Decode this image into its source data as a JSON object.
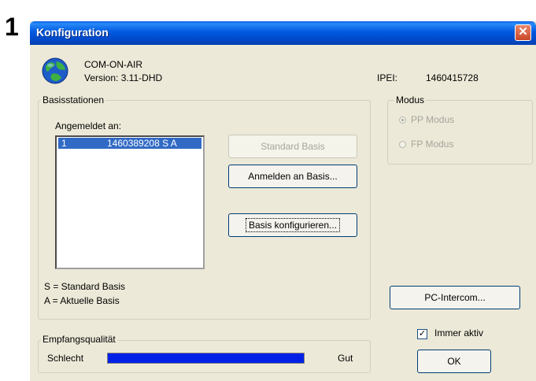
{
  "step_number": "1",
  "window": {
    "title": "Konfiguration",
    "close_glyph": "✕",
    "icon": "globe-icon"
  },
  "app": {
    "name": "COM-ON-AIR",
    "version": "Version: 3.11-DHD"
  },
  "ipei": {
    "label": "IPEI:",
    "value": "1460415728"
  },
  "basisstationen": {
    "legend": "Basisstationen",
    "list_label": "Angemeldet an:",
    "items": [
      {
        "index": "1",
        "text": "1460389208 S A",
        "selected": true
      }
    ],
    "legend_s": "S = Standard Basis",
    "legend_a": "A = Aktuelle Basis"
  },
  "buttons": {
    "standard_basis": "Standard Basis",
    "anmelden": "Anmelden an Basis...",
    "konfigurieren": "Basis konfigurieren...",
    "pc_intercom": "PC-Intercom...",
    "ok": "OK"
  },
  "modus": {
    "legend": "Modus",
    "pp": "PP Modus",
    "fp": "FP Modus",
    "selected": "pp"
  },
  "immer_aktiv": {
    "label": "Immer aktiv",
    "checked": true,
    "check_glyph": "✓"
  },
  "empfang": {
    "legend": "Empfangsqualität",
    "low": "Schlecht",
    "high": "Gut",
    "level": 1.0,
    "color": "#0020e6"
  }
}
